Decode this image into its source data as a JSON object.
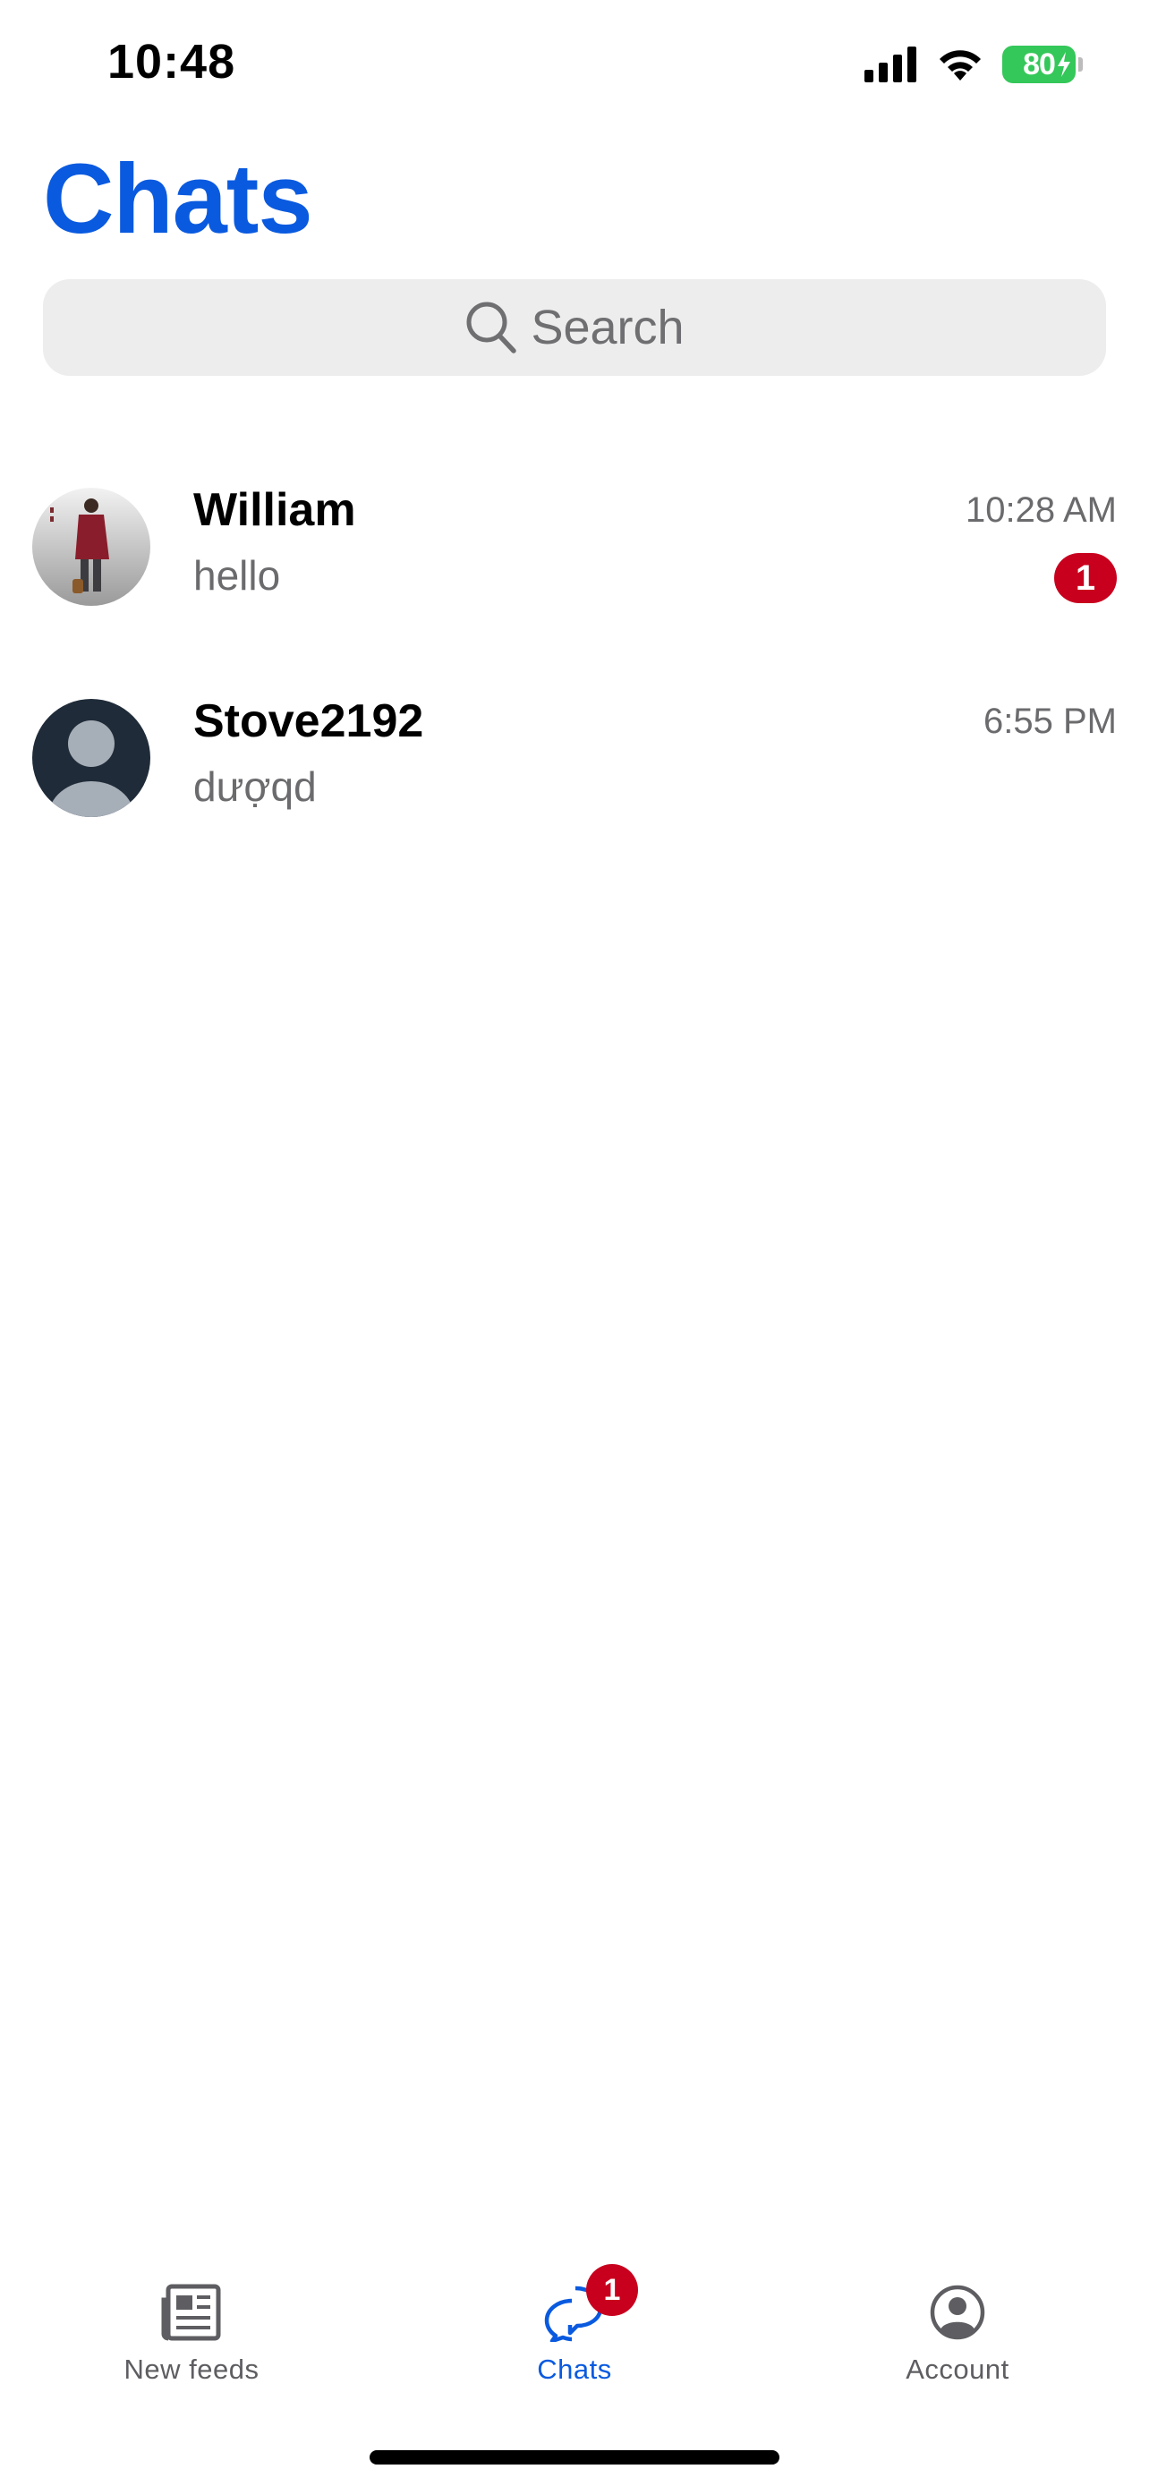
{
  "status_bar": {
    "time": "10:48",
    "battery_level": "80",
    "battery_color": "#34c759",
    "icons": [
      "signal-icon",
      "wifi-icon",
      "battery-icon"
    ]
  },
  "header": {
    "title": "Chats",
    "title_color": "#0a5adf"
  },
  "search": {
    "placeholder": "Search",
    "icon": "search-icon"
  },
  "chats": [
    {
      "name": "William",
      "last_message": "hello",
      "time": "10:28 AM",
      "unread": "1",
      "avatar": "photo-avatar"
    },
    {
      "name": "Stove2192",
      "last_message": "dượqd",
      "time": "6:55 PM",
      "unread": "",
      "avatar": "default-person-avatar"
    }
  ],
  "tab_bar": {
    "tabs": [
      {
        "label": "New feeds",
        "icon": "newspaper-icon",
        "active": false
      },
      {
        "label": "Chats",
        "icon": "chat-bubbles-icon",
        "active": true,
        "badge": "1"
      },
      {
        "label": "Account",
        "icon": "account-circle-icon",
        "active": false
      }
    ],
    "active_color": "#0a5adf",
    "badge_color": "#c8001e"
  }
}
